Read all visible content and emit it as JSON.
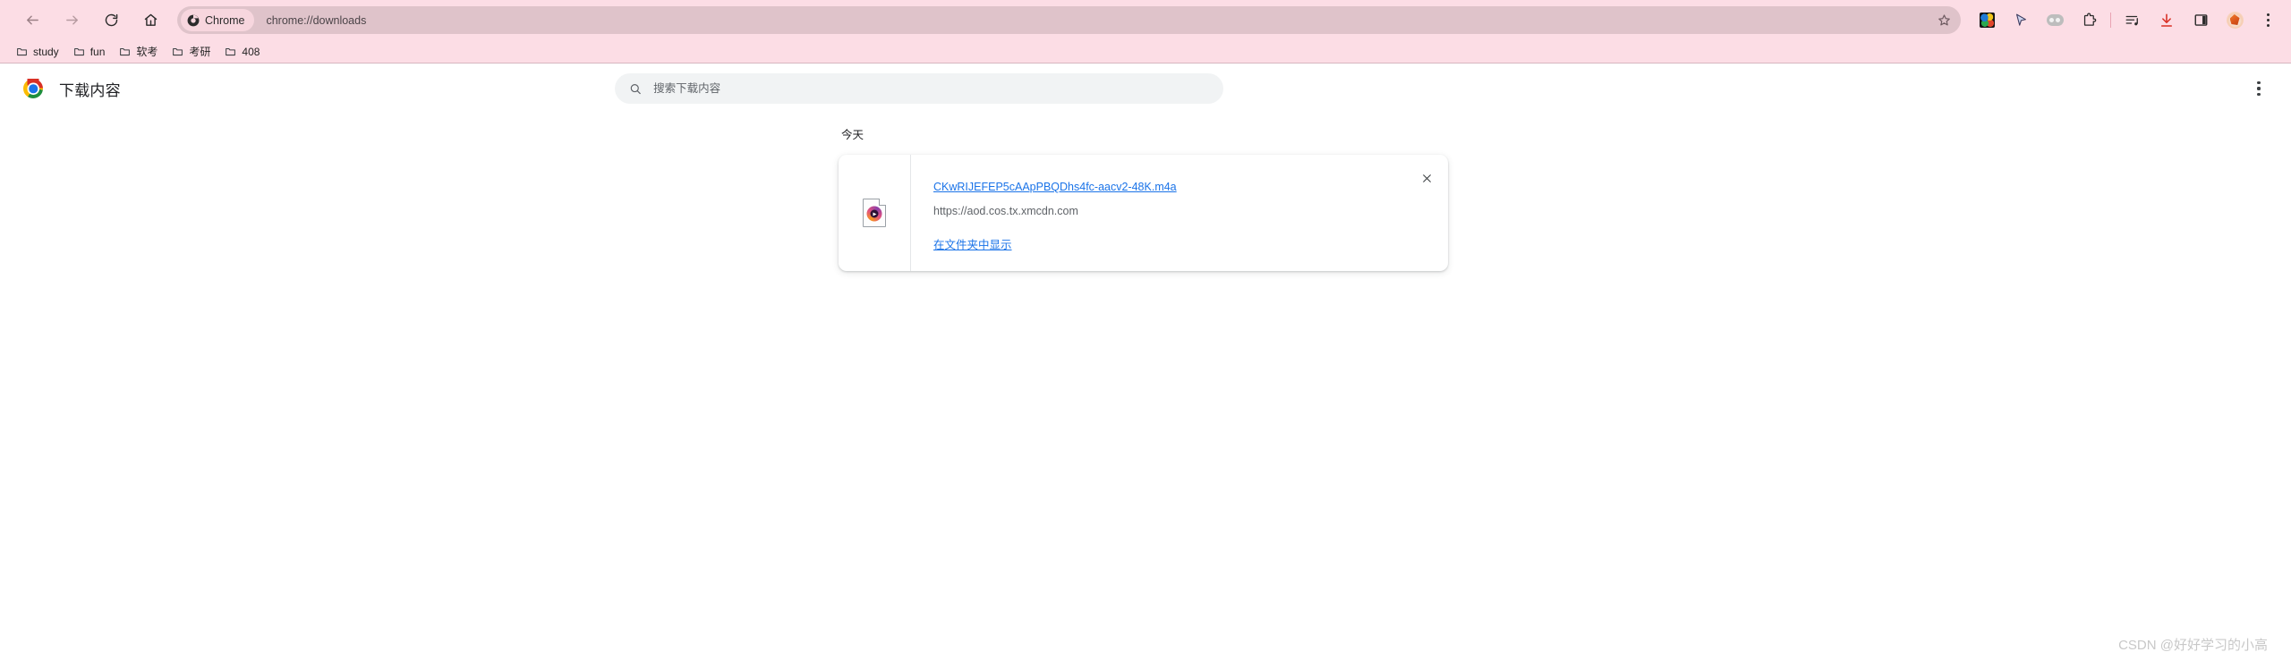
{
  "browser": {
    "nav": {
      "back_label": "Back",
      "forward_label": "Forward",
      "reload_label": "Reload",
      "home_label": "Home"
    },
    "omnibox": {
      "chip_label": "Chrome",
      "url": "chrome://downloads",
      "bookmark_star_label": "Bookmark this tab"
    },
    "toolbar_icons": [
      {
        "name": "globe-extension-icon",
        "label": "Globe extension"
      },
      {
        "name": "cursor-extension-icon",
        "label": "Cursor extension"
      },
      {
        "name": "capsule-extension-icon",
        "label": "Capsule extension"
      },
      {
        "name": "extensions-puzzle-icon",
        "label": "Extensions"
      },
      {
        "name": "media-playlist-icon",
        "label": "Media playlist"
      },
      {
        "name": "downloads-icon",
        "label": "Downloads"
      },
      {
        "name": "side-panel-icon",
        "label": "Side panel"
      },
      {
        "name": "profile-avatar-icon",
        "label": "Profile"
      },
      {
        "name": "chrome-menu-icon",
        "label": "Customize and control Google Chrome"
      }
    ],
    "colors": {
      "toolbar_bg": "#fcdde5",
      "omnibox_bg": "#dfc3ca",
      "chip_bg": "#f7d6de",
      "bookmarks_bg": "#fcdde5",
      "download_icon": "#d93025"
    },
    "bookmarks": [
      {
        "label": "study"
      },
      {
        "label": "fun"
      },
      {
        "label": "软考"
      },
      {
        "label": "考研"
      },
      {
        "label": "408"
      }
    ]
  },
  "page": {
    "title": "下载内容",
    "search": {
      "placeholder": "搜索下载内容",
      "value": ""
    },
    "menu_label": "更多操作",
    "date_group": "今天",
    "download": {
      "file_name": "CKwRIJEFEP5cAApPBQDhs4fc-aacv2-48K.m4a",
      "url": "https://aod.cos.tx.xmcdn.com",
      "show_in_folder": "在文件夹中显示",
      "close_label": "移除"
    }
  },
  "watermark": "CSDN @好好学习的小高"
}
